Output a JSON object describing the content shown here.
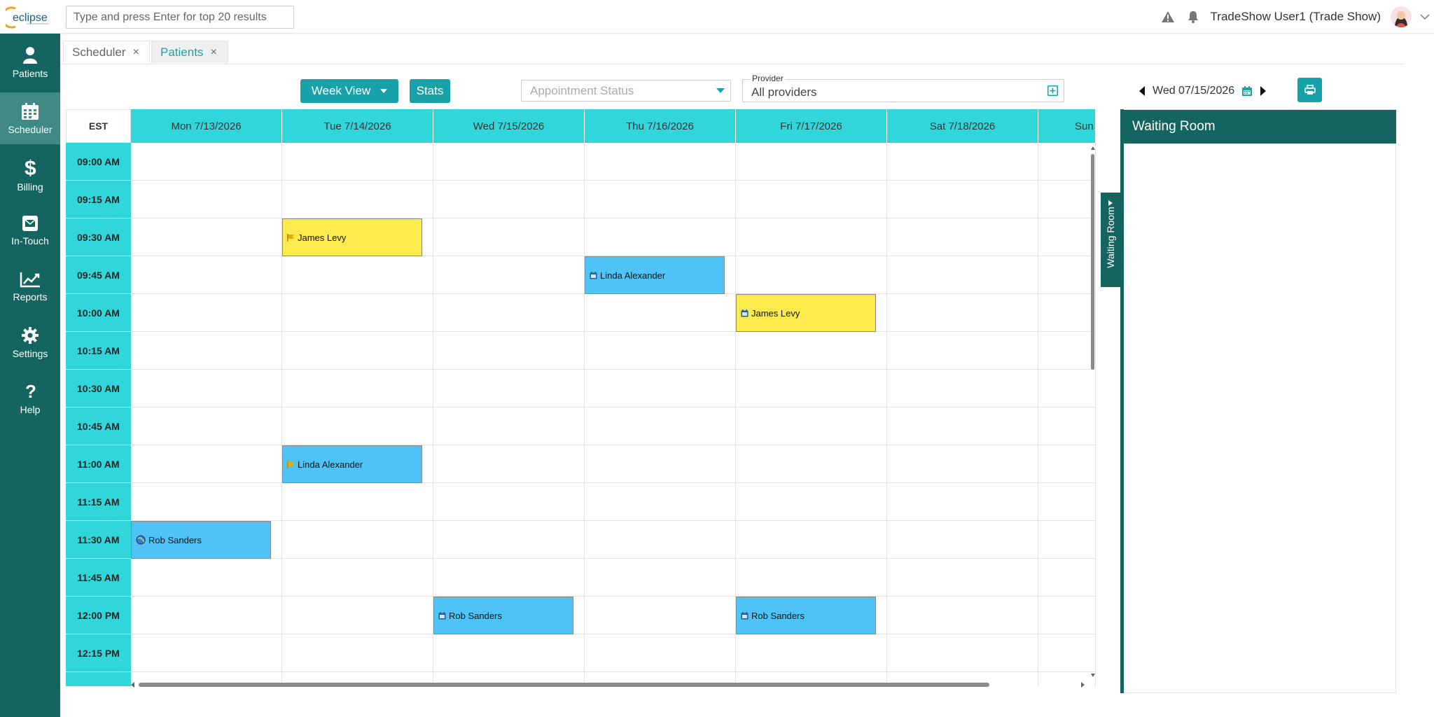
{
  "app": {
    "logo_text": "eclipse",
    "search_placeholder": "Type and press Enter for top 20 results",
    "user_name": "TradeShow User1 (Trade Show)"
  },
  "sidebar": {
    "items": [
      {
        "label": "Patients",
        "icon": "user-icon"
      },
      {
        "label": "Scheduler",
        "icon": "calendar-icon"
      },
      {
        "label": "Billing",
        "icon": "dollar-icon"
      },
      {
        "label": "In-Touch",
        "icon": "envelope-icon"
      },
      {
        "label": "Reports",
        "icon": "line-chart-icon"
      },
      {
        "label": "Settings",
        "icon": "gear-icon"
      },
      {
        "label": "Help",
        "icon": "question-icon"
      }
    ],
    "active": "Scheduler"
  },
  "tabs": [
    {
      "label": "Scheduler",
      "close": "×"
    },
    {
      "label": "Patients",
      "close": "×"
    }
  ],
  "toolbar": {
    "view_label": "Week View",
    "stats_label": "Stats",
    "status_placeholder": "Appointment Status",
    "provider_label": "Provider",
    "provider_value": "All providers",
    "current_date": "Wed 07/15/2026"
  },
  "calendar": {
    "timezone": "EST",
    "days": [
      "Mon  7/13/2026",
      "Tue  7/14/2026",
      "Wed  7/15/2026",
      "Thu  7/16/2026",
      "Fri  7/17/2026",
      "Sat  7/18/2026",
      "Sun"
    ],
    "times": [
      "09:00 AM",
      "09:15 AM",
      "09:30 AM",
      "09:45 AM",
      "10:00 AM",
      "10:15 AM",
      "10:30 AM",
      "10:45 AM",
      "11:00 AM",
      "11:15 AM",
      "11:30 AM",
      "11:45 AM",
      "12:00 PM",
      "12:15 PM"
    ],
    "appointments": [
      {
        "patient": "James Levy",
        "day": 1,
        "slot": 2,
        "color": "yellow",
        "icon": "flag-icon"
      },
      {
        "patient": "Linda Alexander",
        "day": 3,
        "slot": 3,
        "color": "blue",
        "icon": "calendar-icon"
      },
      {
        "patient": "James Levy",
        "day": 4,
        "slot": 4,
        "color": "yellow",
        "icon": "calendar-icon"
      },
      {
        "patient": "Linda Alexander",
        "day": 1,
        "slot": 8,
        "color": "blue",
        "icon": "flag-icon"
      },
      {
        "patient": "Rob Sanders",
        "day": 0,
        "slot": 10,
        "color": "blue",
        "icon": "globe-icon"
      },
      {
        "patient": "Rob Sanders",
        "day": 2,
        "slot": 12,
        "color": "blue",
        "icon": "calendar-icon"
      },
      {
        "patient": "Rob Sanders",
        "day": 4,
        "slot": 12,
        "color": "blue",
        "icon": "calendar-icon"
      }
    ]
  },
  "waiting_room": {
    "title": "Waiting Room",
    "tab_label": "Waiting Room"
  },
  "colors": {
    "sidebar": "#14655f",
    "accent": "#17a2aa",
    "header_cyan": "#31d6da",
    "appt_yellow": "#fdeb4e",
    "appt_blue": "#4fc3f5"
  }
}
